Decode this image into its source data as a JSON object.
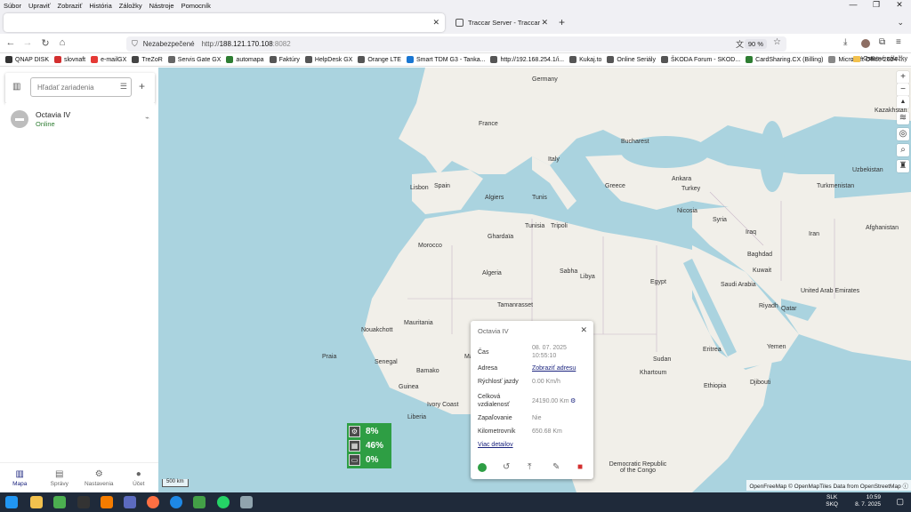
{
  "menu": [
    "Súbor",
    "Upraviť",
    "Zobraziť",
    "História",
    "Záložky",
    "Nástroje",
    "Pomocník"
  ],
  "tabs": [
    {
      "label": "",
      "active": true
    },
    {
      "label": "Traccar Server - Traccar",
      "active": false
    }
  ],
  "nav": {
    "security_label": "Nezabezpečené",
    "url_scheme": "http://",
    "url_host": "188.121.170.108",
    "url_port": ":8082",
    "zoom": "90 %"
  },
  "bookmarks": [
    {
      "label": "QNAP DISK",
      "color": "#333333"
    },
    {
      "label": "slovnaft",
      "color": "#d32f2f"
    },
    {
      "label": "e-mailGX",
      "color": "#e53935"
    },
    {
      "label": "TreZoR",
      "color": "#444444"
    },
    {
      "label": "Servis Gate GX",
      "color": "#666666"
    },
    {
      "label": "automapa",
      "color": "#2e7d32"
    },
    {
      "label": "Faktúry",
      "color": "#555555"
    },
    {
      "label": "HelpDesk GX",
      "color": "#555555"
    },
    {
      "label": "Orange LTE",
      "color": "#555555"
    },
    {
      "label": "Smart TDM G3 - Tanka...",
      "color": "#1976d2"
    },
    {
      "label": "http://192.168.254.1/i...",
      "color": "#555555"
    },
    {
      "label": "Kukaj.to",
      "color": "#555555"
    },
    {
      "label": "Online Seriály",
      "color": "#555555"
    },
    {
      "label": "ŠKODA Forum - SKOD...",
      "color": "#555555"
    },
    {
      "label": "CardSharing.CX (Billing)",
      "color": "#2e7d32"
    },
    {
      "label": "Microsoft Office 2024 ...",
      "color": "#888888"
    }
  ],
  "bookmarks_other": "Ostatné záložky",
  "sidebar": {
    "search_placeholder": "Hľadať zariadenia",
    "devices": [
      {
        "name": "Octavia IV",
        "status": "Online"
      }
    ],
    "nav": [
      {
        "label": "Mapa",
        "icon": "map-icon",
        "active": true
      },
      {
        "label": "Správy",
        "icon": "report-icon",
        "active": false
      },
      {
        "label": "Nastavenia",
        "icon": "gear-icon",
        "active": false
      },
      {
        "label": "Účet",
        "icon": "person-icon",
        "active": false
      }
    ]
  },
  "map": {
    "labels": [
      "Germany",
      "France",
      "Italy",
      "Spain",
      "Lisbon",
      "Morocco",
      "Algeria",
      "Algiers",
      "Tunis",
      "Tunisia",
      "Tripoli",
      "Libya",
      "Egypt",
      "Turkey",
      "Greece",
      "Syria",
      "Iraq",
      "Iran",
      "Saudi Arabia",
      "Mauritania",
      "Mali",
      "Niger",
      "Sudan",
      "Ethiopia",
      "Senegal",
      "Guinea",
      "Bamako",
      "Ivory Coast",
      "Liberia",
      "Yemen",
      "Nicosia",
      "Ankara",
      "Bucharest",
      "Turkmenistan",
      "Uzbekistan",
      "Afghanistan",
      "Kazakhstan",
      "Democratic Republic of the Congo",
      "Praia",
      "Nouakchott",
      "Ghardaïa",
      "Tamanrasset",
      "Sabha",
      "Eritrea",
      "Djibouti",
      "Khartoum",
      "United Arab Emirates",
      "Qatar",
      "Kuwait",
      "Riyadh",
      "Baghdad"
    ],
    "scale": "500 km",
    "attribution": "OpenFreeMap © OpenMapTiles Data from OpenStreetMap"
  },
  "gauge": [
    {
      "icon": "gear-icon",
      "value": "8%"
    },
    {
      "icon": "memory-icon",
      "value": "46%"
    },
    {
      "icon": "disk-icon",
      "value": "0%"
    }
  ],
  "popup": {
    "title": "Octavia IV",
    "rows": [
      {
        "key": "Čas",
        "value": "08. 07. 2025 10:55:10"
      },
      {
        "key": "Adresa",
        "value": "Zobraziť adresu"
      },
      {
        "key": "Rýchlosť jazdy",
        "value": "0.00 Km/h"
      },
      {
        "key": "Celková vzdialenosť",
        "value": "24190.00 Km"
      },
      {
        "key": "Zapaľovanie",
        "value": "Nie"
      },
      {
        "key": "Kilometrovník",
        "value": "650.68 Km"
      }
    ],
    "more_link": "Viac detailov"
  },
  "taskbar": {
    "lang_1": "SLK",
    "lang_2": "SKQ",
    "time": "10:59",
    "date": "8. 7. 2025"
  }
}
